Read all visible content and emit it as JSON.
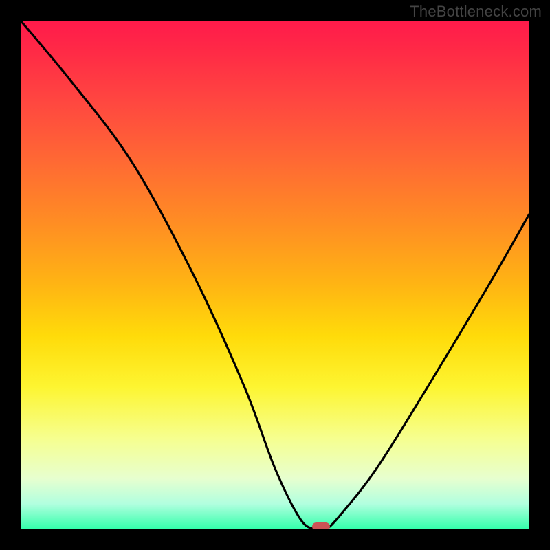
{
  "watermark": "TheBottleneck.com",
  "chart_data": {
    "type": "line",
    "title": "",
    "xlabel": "",
    "ylabel": "",
    "xlim": [
      0,
      100
    ],
    "ylim": [
      0,
      100
    ],
    "series": [
      {
        "name": "bottleneck-curve",
        "x": [
          0,
          10,
          22,
          34,
          44,
          50,
          55,
          58,
          60,
          63,
          70,
          80,
          92,
          100
        ],
        "values": [
          100,
          88,
          72,
          50,
          28,
          12,
          2,
          0,
          0,
          3,
          12,
          28,
          48,
          62
        ]
      }
    ],
    "marker": {
      "x": 59,
      "y": 0,
      "name": "optimal-point"
    },
    "grid": false,
    "legend": false
  },
  "colors": {
    "curve": "#000000",
    "marker": "#cb5456",
    "frame": "#000000"
  }
}
